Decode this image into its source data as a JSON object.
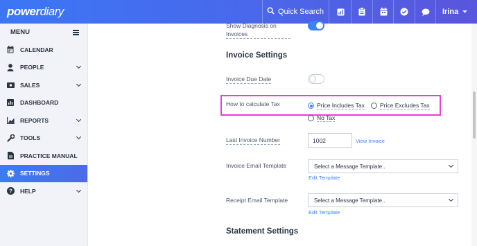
{
  "app": {
    "logo_bold": "power",
    "logo_light": "diary"
  },
  "topbar": {
    "search_label": "Quick Search",
    "user_name": "Irina",
    "icons": [
      "search-icon",
      "calendar-report-icon",
      "clipboard-icon",
      "calendar-icon",
      "check-circle-icon",
      "chat-icon"
    ]
  },
  "sidebar": {
    "menu_label": "MENU",
    "items": [
      {
        "label": "CALENDAR",
        "icon": "calendar-icon",
        "has_children": false,
        "active": false
      },
      {
        "label": "PEOPLE",
        "icon": "person-icon",
        "has_children": true,
        "active": false
      },
      {
        "label": "SALES",
        "icon": "money-icon",
        "has_children": true,
        "active": false
      },
      {
        "label": "DASHBOARD",
        "icon": "dashboard-icon",
        "has_children": false,
        "active": false
      },
      {
        "label": "REPORTS",
        "icon": "chart-icon",
        "has_children": true,
        "active": false
      },
      {
        "label": "TOOLS",
        "icon": "wrench-icon",
        "has_children": true,
        "active": false
      },
      {
        "label": "PRACTICE MANUAL",
        "icon": "document-icon",
        "has_children": false,
        "active": false
      },
      {
        "label": "SETTINGS",
        "icon": "gear-icon",
        "has_children": false,
        "active": true
      },
      {
        "label": "HELP",
        "icon": "help-icon",
        "has_children": true,
        "active": false
      }
    ]
  },
  "main": {
    "show_diagnosis": {
      "label_line1": "Show Diagnosis on",
      "label_line2": "Invoices",
      "enabled": true
    },
    "invoice_settings_title": "Invoice Settings",
    "invoice_due_date": {
      "label": "Invoice Due Date",
      "enabled": false
    },
    "tax": {
      "label": "How to calculate Tax",
      "options": [
        "Price Includes Tax",
        "Price Excludes Tax",
        "No Tax"
      ],
      "selected": "Price Includes Tax"
    },
    "last_invoice": {
      "label": "Last Invoice Number",
      "value": "1002",
      "link": "View Invoice"
    },
    "invoice_email": {
      "label": "Invoice Email Template",
      "value": "Select a Message Template..",
      "link": "Edit Template"
    },
    "receipt_email": {
      "label": "Receipt Email Template",
      "value": "Select a Message Template..",
      "link": "Edit Template"
    },
    "statement_settings_title": "Statement Settings"
  },
  "colors": {
    "accent": "#3b82f6",
    "highlight": "#e83fd0",
    "sidebar_bg": "#f1f3f8"
  }
}
